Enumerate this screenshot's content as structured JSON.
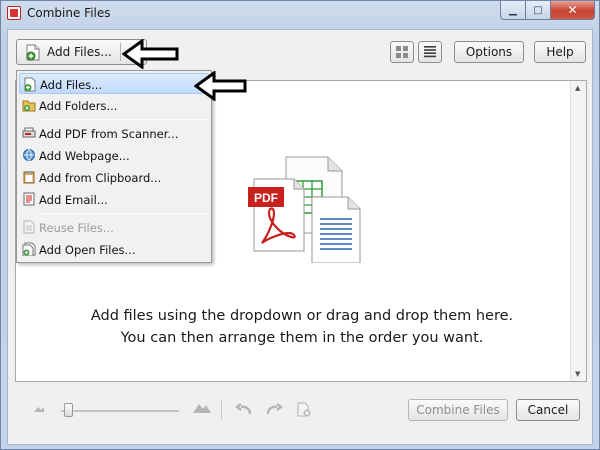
{
  "window": {
    "title": "Combine Files",
    "controls": {
      "minimize": "▁",
      "maximize": "□",
      "close": "✕"
    }
  },
  "toolbar": {
    "add_files_label": "Add Files...",
    "options_label": "Options",
    "help_label": "Help"
  },
  "add_menu": {
    "items": [
      {
        "label": "Add Files...",
        "icon": "add-files-icon",
        "highlighted": true
      },
      {
        "label": "Add Folders...",
        "icon": "add-folder-icon"
      },
      {
        "label": "Add PDF from Scanner...",
        "icon": "scanner-icon"
      },
      {
        "label": "Add Webpage...",
        "icon": "web-icon"
      },
      {
        "label": "Add from Clipboard...",
        "icon": "clipboard-icon"
      },
      {
        "label": "Add Email...",
        "icon": "email-icon"
      },
      {
        "label": "Reuse Files...",
        "icon": "reuse-files-icon",
        "disabled": true
      },
      {
        "label": "Add Open Files...",
        "icon": "open-files-icon"
      }
    ]
  },
  "dropzone": {
    "hint_line1": "Add files using the dropdown or drag and drop them here.",
    "hint_line2": "You can then arrange them in the order you want.",
    "pdf_badge": "PDF"
  },
  "footer": {
    "combine_label": "Combine Files",
    "cancel_label": "Cancel"
  },
  "colors": {
    "accent_red": "#cc2222",
    "sheet_green": "#2e9a3a",
    "doc_blue": "#2a63b8",
    "menu_highlight": "#c1dbfc"
  }
}
